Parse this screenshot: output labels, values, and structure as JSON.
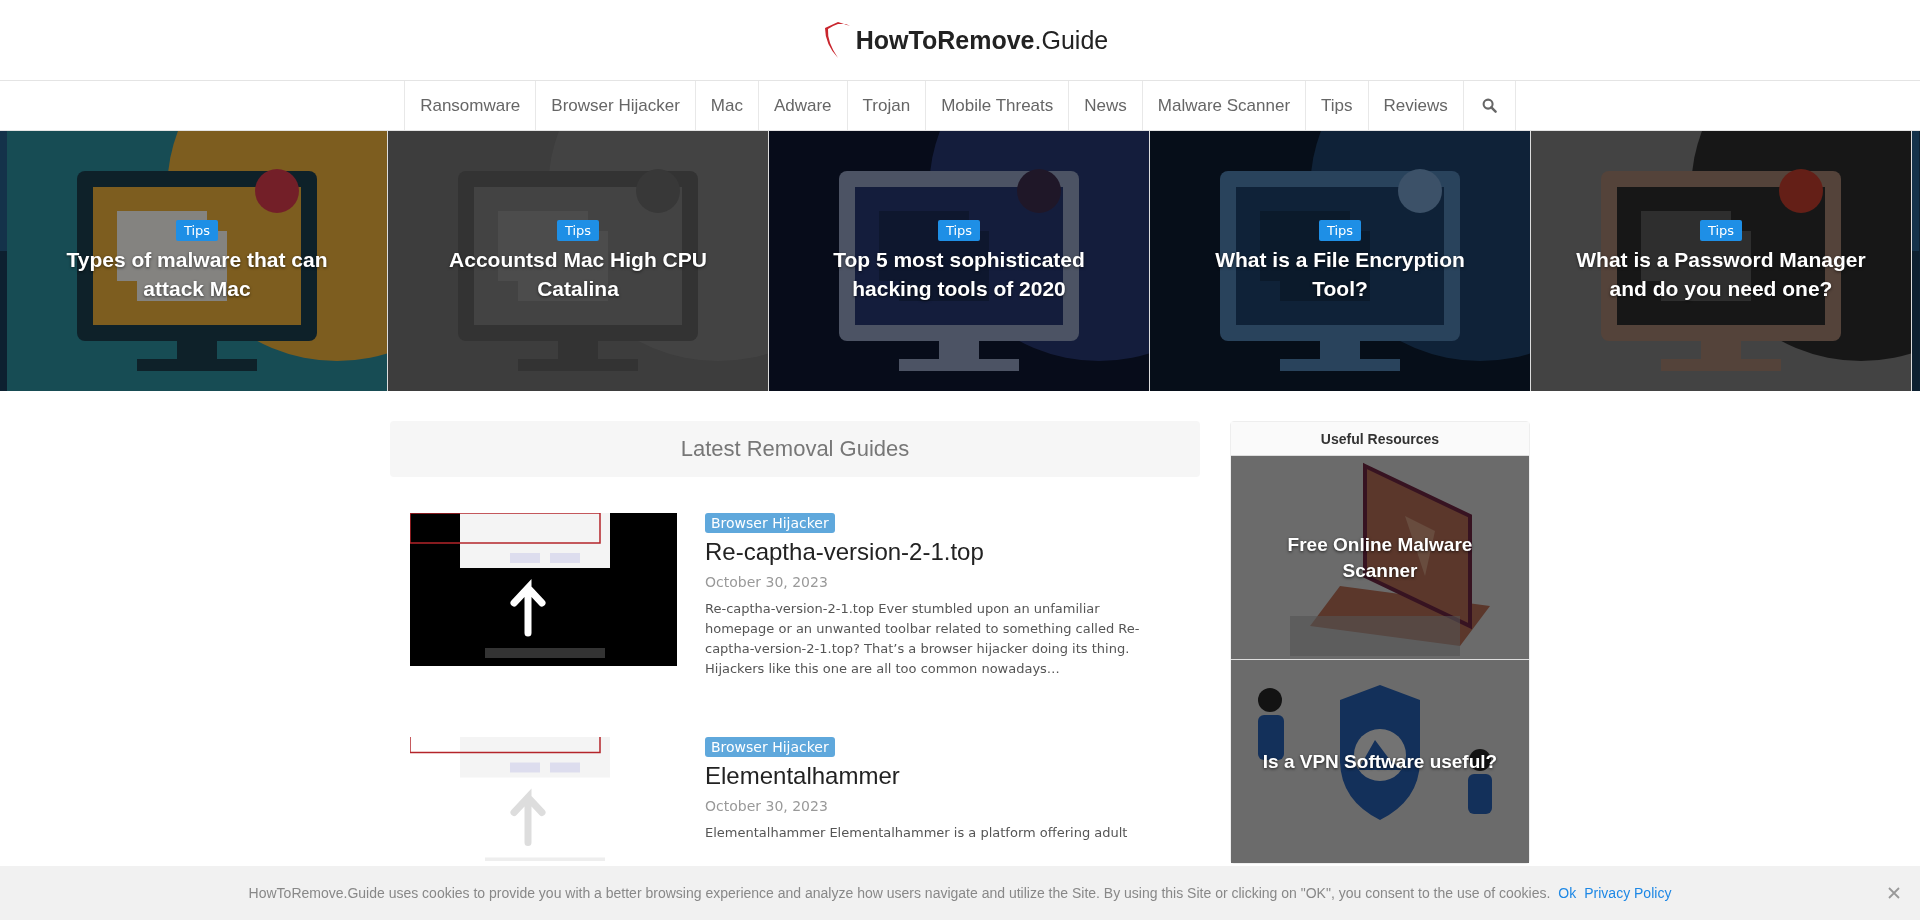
{
  "logo": {
    "text": "**HowToRemove**.Guide"
  },
  "nav": {
    "items": [
      "Ransomware",
      "Browser Hijacker",
      "Mac",
      "Adware",
      "Trojan",
      "Mobile Threats",
      "News",
      "Malware Scanner",
      "Tips",
      "Reviews"
    ]
  },
  "slider": [
    {
      "kind": "picture",
      "tag": "Tips",
      "title": "Types of malware that can attack Mac"
    },
    {
      "kind": "picture",
      "tag": "Tips",
      "title": "Accountsd Mac High CPU Catalina"
    },
    {
      "kind": "picture",
      "tag": "Tips",
      "title": "Top 5 most sophisticated hacking tools of 2020"
    },
    {
      "kind": "picture",
      "tag": "Tips",
      "title": "What is a File Encryption Tool?"
    },
    {
      "kind": "picture",
      "tag": "Tips",
      "title": "What is a Password Manager and do you need one?"
    }
  ],
  "latest": {
    "heading": "Latest Removal Guides",
    "articles": [
      {
        "kind": "picture",
        "category": "Browser Hijacker",
        "title": "Re-captha-version-2-1.top",
        "date": "October 30, 2023",
        "excerpt": "Re-captha-version-2-1.top Ever stumbled upon an unfamiliar homepage or an unwanted toolbar related to something called Re-captha-version-2-1.top? That’s a browser hijacker doing its thing. Hijackers like this one are all too common nowadays…"
      },
      {
        "kind": "picture",
        "category": "Browser Hijacker",
        "title": "Elementalhammer",
        "date": "October 30, 2023",
        "excerpt": "Elementalhammer Elementalhammer is a platform offering adult"
      }
    ]
  },
  "sidebar": {
    "heading": "Useful Resources",
    "items": [
      {
        "kind": "picture",
        "title": "Free Online Malware Scanner"
      },
      {
        "kind": "picture",
        "title": "Is a VPN Software useful?"
      }
    ]
  },
  "cookie_bar": {
    "text": "HowToRemove.Guide uses cookies to provide you with a better browsing experience and analyze how users navigate and utilize the Site. By using this Site or clicking on \"OK\", you consent to the use of cookies.",
    "ok": "Ok",
    "policy": "Privacy Policy"
  }
}
